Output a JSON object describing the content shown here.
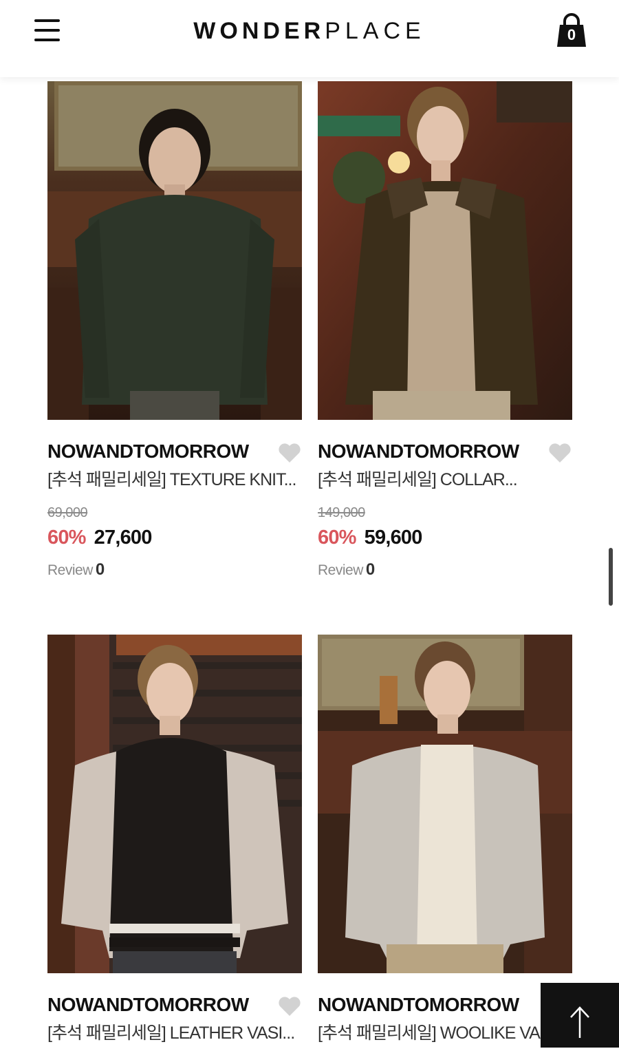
{
  "header": {
    "logo_bold": "WONDER",
    "logo_light": "PLACE",
    "cart_count": "0"
  },
  "colors": {
    "discount": "#d9565c",
    "text": "#111111",
    "muted": "#888888"
  },
  "products": [
    {
      "brand": "NOWANDTOMORROW",
      "name": "[추석 패밀리세일] TEXTURE KNIT...",
      "original_price": "69,000",
      "discount": "60%",
      "price": "27,600",
      "review_label": "Review",
      "review_count": "0"
    },
    {
      "brand": "NOWANDTOMORROW",
      "name": "[추석 패밀리세일] COLLAR...",
      "original_price": "149,000",
      "discount": "60%",
      "price": "59,600",
      "review_label": "Review",
      "review_count": "0"
    },
    {
      "brand": "NOWANDTOMORROW",
      "name": "[추석 패밀리세일] LEATHER VASI..."
    },
    {
      "brand": "NOWANDTOMORROW",
      "name": "[추석 패밀리세일] WOOLIKE VAS..."
    }
  ]
}
